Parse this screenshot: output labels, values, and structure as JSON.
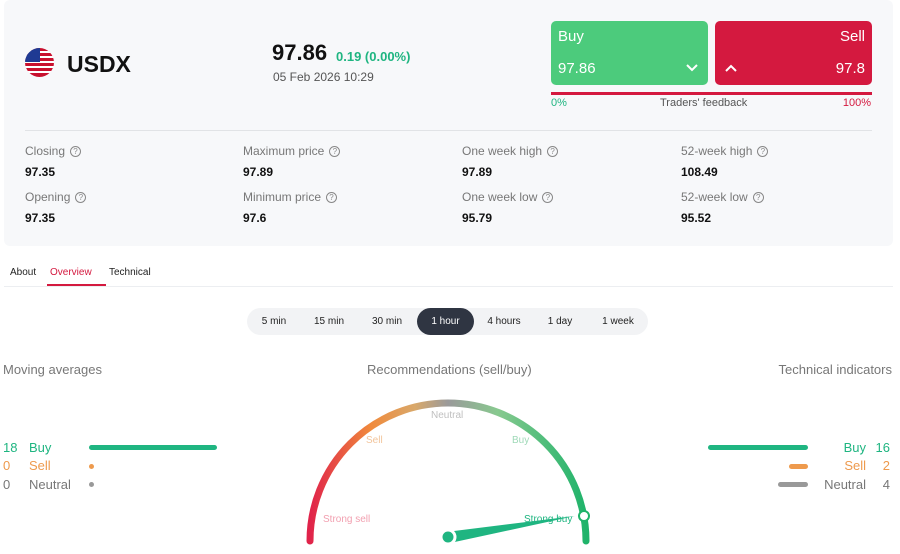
{
  "instrument": {
    "symbol": "USDX",
    "flag_icon": "us-flag-icon",
    "price": "97.86",
    "change": "0.19 (0.00%)",
    "datetime": "05 Feb 2026 10:29"
  },
  "trade": {
    "buy_label": "Buy",
    "buy_value": "97.86",
    "sell_label": "Sell",
    "sell_value": "97.8",
    "feedback_left": "0%",
    "feedback_label": "Traders' feedback",
    "feedback_right": "100%",
    "buy_share": 0
  },
  "stats": [
    {
      "label": "Closing",
      "value": "97.35"
    },
    {
      "label": "Maximum price",
      "value": "97.89"
    },
    {
      "label": "One week high",
      "value": "97.89"
    },
    {
      "label": "52-week high",
      "value": "108.49"
    },
    {
      "label": "Opening",
      "value": "97.35"
    },
    {
      "label": "Minimum price",
      "value": "97.6"
    },
    {
      "label": "One week low",
      "value": "95.79"
    },
    {
      "label": "52-week low",
      "value": "95.52"
    }
  ],
  "tabs": [
    {
      "label": "About"
    },
    {
      "label": "Overview"
    },
    {
      "label": "Technical"
    }
  ],
  "active_tab": "Overview",
  "periods": [
    {
      "label": "5 min"
    },
    {
      "label": "15 min"
    },
    {
      "label": "30 min"
    },
    {
      "label": "1 hour"
    },
    {
      "label": "4 hours"
    },
    {
      "label": "1 day"
    },
    {
      "label": "1 week"
    }
  ],
  "active_period": "1 hour",
  "moving_averages": {
    "title": "Moving averages",
    "rows": [
      {
        "count": "18",
        "label": "Buy"
      },
      {
        "count": "0",
        "label": "Sell"
      },
      {
        "count": "0",
        "label": "Neutral"
      }
    ]
  },
  "recommendations": {
    "title": "Recommendations (sell/buy)",
    "labels": {
      "strong_sell": "Strong sell",
      "sell": "Sell",
      "neutral": "Neutral",
      "buy": "Buy",
      "strong_buy": "Strong buy"
    },
    "needle_level": "Strong buy"
  },
  "technical_indicators": {
    "title": "Technical indicators",
    "rows": [
      {
        "label": "Buy",
        "count": "16"
      },
      {
        "label": "Sell",
        "count": "2"
      },
      {
        "label": "Neutral",
        "count": "4"
      }
    ]
  },
  "colors": {
    "buy": "#4ccb7c",
    "sell": "#d4193f",
    "positive": "#1fb581",
    "sell_orange": "#ee9a4d",
    "neutral_grey": "#999999"
  }
}
